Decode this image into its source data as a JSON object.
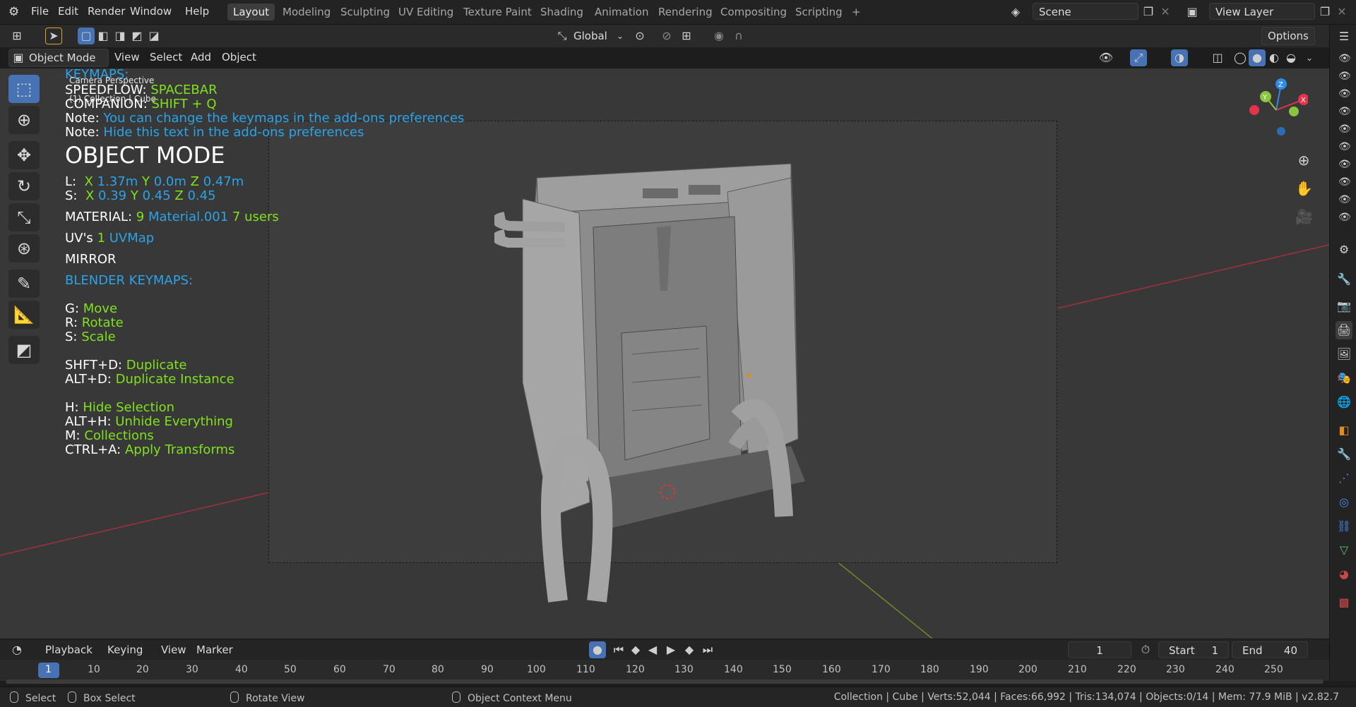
{
  "topbar": {
    "menus": [
      "File",
      "Edit",
      "Render",
      "Window",
      "Help"
    ],
    "workspaces": [
      "Layout",
      "Modeling",
      "Sculpting",
      "UV Editing",
      "Texture Paint",
      "Shading",
      "Animation",
      "Rendering",
      "Compositing",
      "Scripting"
    ],
    "add_tab": "+",
    "scene": "Scene",
    "view_layer": "View Layer"
  },
  "toolheader": {
    "orientation": "Global",
    "options": "Options"
  },
  "viewheader": {
    "mode": "Object Mode",
    "menus": [
      "View",
      "Select",
      "Add",
      "Object"
    ]
  },
  "overlay": {
    "keymaps_title": "KEYMAPS:",
    "camera_label": "Camera Perspective",
    "collection_label": "(1) Collection | Cube",
    "speedflow_key": "SPEEDFLOW:",
    "speedflow_val": "SPACEBAR",
    "companion_key": "COMPANION:",
    "companion_val": "SHIFT + Q",
    "note1_key": "Note:",
    "note1_val": "You can change the keymaps in the add-ons preferences",
    "note2_key": "Note:",
    "note2_val": "Hide this text in the add-ons preferences",
    "mode_title": "OBJECT MODE",
    "loc_key": "L:",
    "loc_x": "X",
    "loc_xv": "1.37m",
    "loc_y": "Y",
    "loc_yv": "0.0m",
    "loc_z": "Z",
    "loc_zv": "0.47m",
    "scale_key": "S:",
    "scale_x": "X",
    "scale_xv": "0.39",
    "scale_y": "Y",
    "scale_yv": "0.45",
    "scale_z": "Z",
    "scale_zv": "0.45",
    "material_key": "MATERIAL:",
    "material_count": "9",
    "material_name": "Material.001",
    "material_users": "7 users",
    "uv_key": "UV's",
    "uv_count": "1",
    "uv_name": "UVMap",
    "mirror": "MIRROR",
    "blender_keymaps": "BLENDER KEYMAPS:",
    "keys": [
      {
        "k": "G:",
        "v": "Move"
      },
      {
        "k": "R:",
        "v": "Rotate"
      },
      {
        "k": "S:",
        "v": "Scale"
      },
      {
        "k": "SHFT+D:",
        "v": "Duplicate"
      },
      {
        "k": "ALT+D:",
        "v": "Duplicate Instance"
      },
      {
        "k": "H:",
        "v": "Hide Selection"
      },
      {
        "k": "ALT+H:",
        "v": "Unhide Everything"
      },
      {
        "k": "M:",
        "v": "Collections"
      },
      {
        "k": "CTRL+A:",
        "v": "Apply Transforms"
      }
    ]
  },
  "gizmo": {
    "z": "Z",
    "y": "Y",
    "x": "X"
  },
  "timeline": {
    "menus": [
      "Playback",
      "Keying",
      "View",
      "Marker"
    ],
    "current_frame": "1",
    "start_label": "Start",
    "start": "1",
    "end_label": "End",
    "end": "40",
    "ticks": [
      "1",
      "10",
      "20",
      "30",
      "40",
      "50",
      "60",
      "70",
      "80",
      "90",
      "100",
      "110",
      "120",
      "130",
      "140",
      "150",
      "160",
      "170",
      "180",
      "190",
      "200",
      "210",
      "220",
      "230",
      "240",
      "250"
    ]
  },
  "statusbar": {
    "select": "Select",
    "box_select": "Box Select",
    "rotate_view": "Rotate View",
    "context_menu": "Object Context Menu",
    "stats": "Collection | Cube | Verts:52,044 | Faces:66,992 | Tris:134,074 | Objects:0/14 | Mem: 77.9 MiB | v2.82.7"
  },
  "colors": {
    "accent": "#4772b3",
    "overlay_blue": "#2aa3e8",
    "overlay_green": "#7fe21c",
    "axis_x": "#e2344b",
    "axis_y": "#8bc53f",
    "axis_z": "#2c8ce6"
  }
}
